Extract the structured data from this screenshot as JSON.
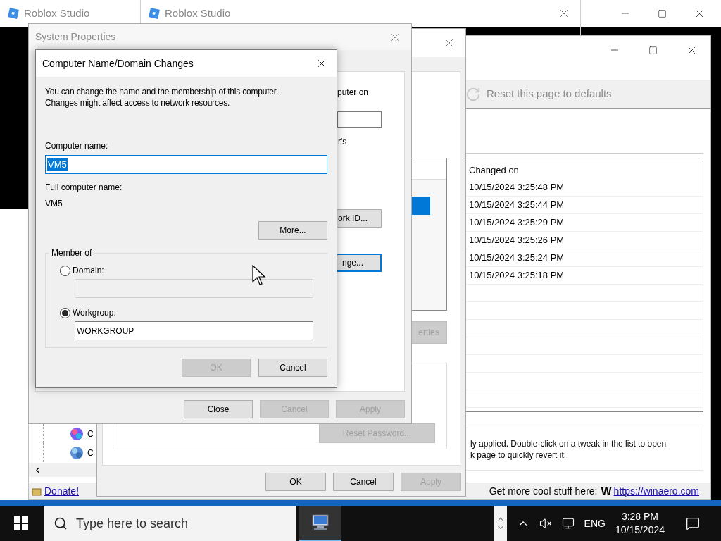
{
  "roblox_windows": [
    {
      "title": "Roblox Studio"
    },
    {
      "title": "Roblox Studio"
    }
  ],
  "winaero": {
    "tree_items": [
      {
        "label": "C"
      },
      {
        "label": "C"
      }
    ],
    "toolbar_button": "Reset this page to defaults",
    "list": {
      "columns": [
        "Changed on"
      ],
      "rows": [
        {
          "changed_on": "10/15/2024 3:25:48 PM"
        },
        {
          "changed_on": "10/15/2024 3:25:44 PM"
        },
        {
          "changed_on": "10/15/2024 3:25:29 PM"
        },
        {
          "changed_on": "10/15/2024 3:25:26 PM"
        },
        {
          "changed_on": "10/15/2024 3:25:24 PM"
        },
        {
          "changed_on": "10/15/2024 3:25:18 PM"
        }
      ]
    },
    "description_lines": [
      "ly applied. Double-click on a tweak in the list to open",
      "k page to quickly revert it."
    ],
    "status_bar": {
      "donate_link": "Donate!",
      "promo": "Get more cool stuff here:",
      "logo_letter": "W",
      "link": "https://winaero.com"
    }
  },
  "user_accounts": {
    "properties_button": {
      "label": "erties",
      "disabled": true
    },
    "reset_password_button": {
      "label": "Reset Password...",
      "disabled": true
    },
    "buttons": [
      {
        "label": "OK",
        "disabled": false
      },
      {
        "label": "Cancel",
        "disabled": false
      },
      {
        "label": "Apply",
        "disabled": true
      }
    ]
  },
  "system_properties": {
    "title": "System Properties",
    "active": false,
    "text_fragments": [
      "puter on",
      "r's"
    ],
    "buttons": [
      {
        "label": "ork ID...",
        "focused": false
      },
      {
        "label": "nge...",
        "focused": true
      }
    ],
    "dialog_buttons": [
      {
        "label": "Close",
        "disabled": false
      },
      {
        "label": "Cancel",
        "disabled": true
      },
      {
        "label": "Apply",
        "disabled": true
      }
    ]
  },
  "name_dialog": {
    "title": "Computer Name/Domain Changes",
    "intro_lines": [
      "You can change the name and the membership of this computer.",
      "Changes might affect access to network resources."
    ],
    "computer_name_label": "Computer name:",
    "computer_name": "VM5",
    "full_name_label": "Full computer name:",
    "full_name": "VM5",
    "more_button": "More...",
    "member_of": {
      "legend": "Member of",
      "options": [
        {
          "label": "Domain:",
          "selected": false
        },
        {
          "label": "Workgroup:",
          "selected": true,
          "value": "WORKGROUP"
        }
      ]
    },
    "buttons": [
      {
        "label": "OK",
        "disabled": true
      },
      {
        "label": "Cancel",
        "disabled": false
      }
    ]
  },
  "taskbar": {
    "search_placeholder": "Type here to search",
    "language": "ENG",
    "time": "3:28 PM",
    "date": "10/15/2024"
  }
}
